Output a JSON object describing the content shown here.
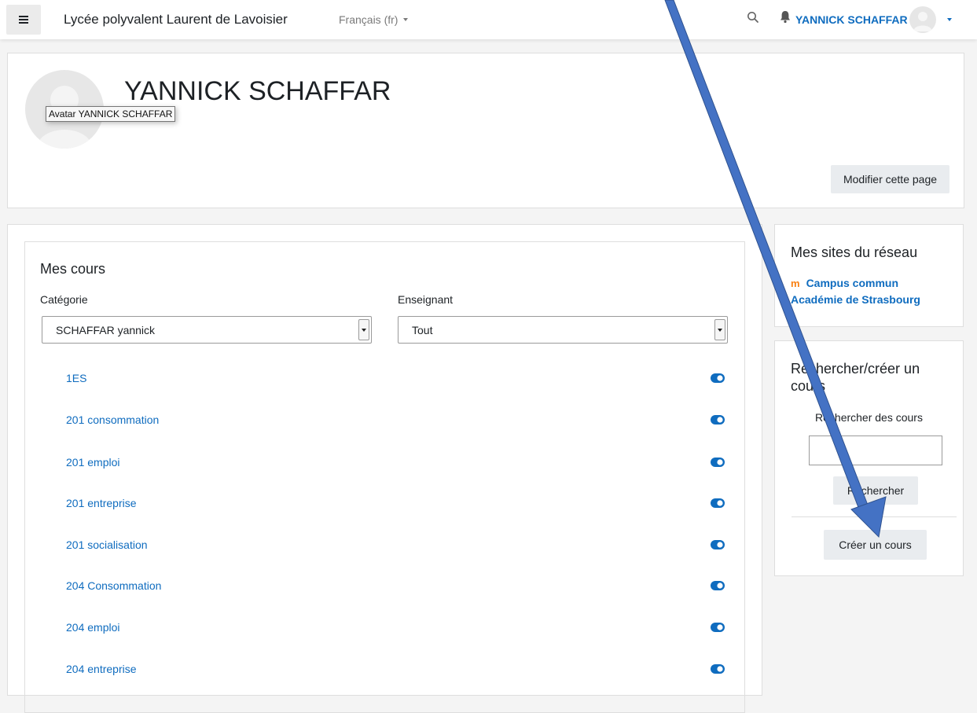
{
  "navbar": {
    "site_name": "Lycée polyvalent Laurent de Lavoisier",
    "language": "Français (fr)",
    "user_name": "YANNICK SCHAFFAR",
    "icons": [
      "menu-icon",
      "search-icon",
      "bell-icon",
      "user-avatar-icon",
      "caret-down-icon"
    ]
  },
  "header": {
    "title": "YANNICK SCHAFFAR",
    "avatar_tooltip": "Avatar YANNICK SCHAFFAR",
    "edit_button": "Modifier cette page"
  },
  "courses_block": {
    "title": "Mes cours",
    "category_label": "Catégorie",
    "category_value": "SCHAFFAR yannick",
    "teacher_label": "Enseignant",
    "teacher_value": "Tout",
    "courses": [
      "1ES",
      "201 consommation",
      "201 emploi",
      "201 entreprise",
      "201 socialisation",
      "204 Consommation",
      "204 emploi",
      "204 entreprise"
    ]
  },
  "network_block": {
    "title": "Mes sites du réseau",
    "logo": "m",
    "link_line1": "Campus commun",
    "link_line2": "Académie de Strasbourg"
  },
  "search_block": {
    "title_line1": "Rechercher/créer un",
    "title_line2": "cours",
    "search_label": "Rechercher des cours",
    "search_placeholder": "",
    "search_button": "Rechercher",
    "create_button": "Créer un cours"
  },
  "colors": {
    "link": "#0f6cbf",
    "arrow": "#4472c4",
    "arrow_outline": "#2f528f",
    "moodle_orange": "#f98012"
  }
}
